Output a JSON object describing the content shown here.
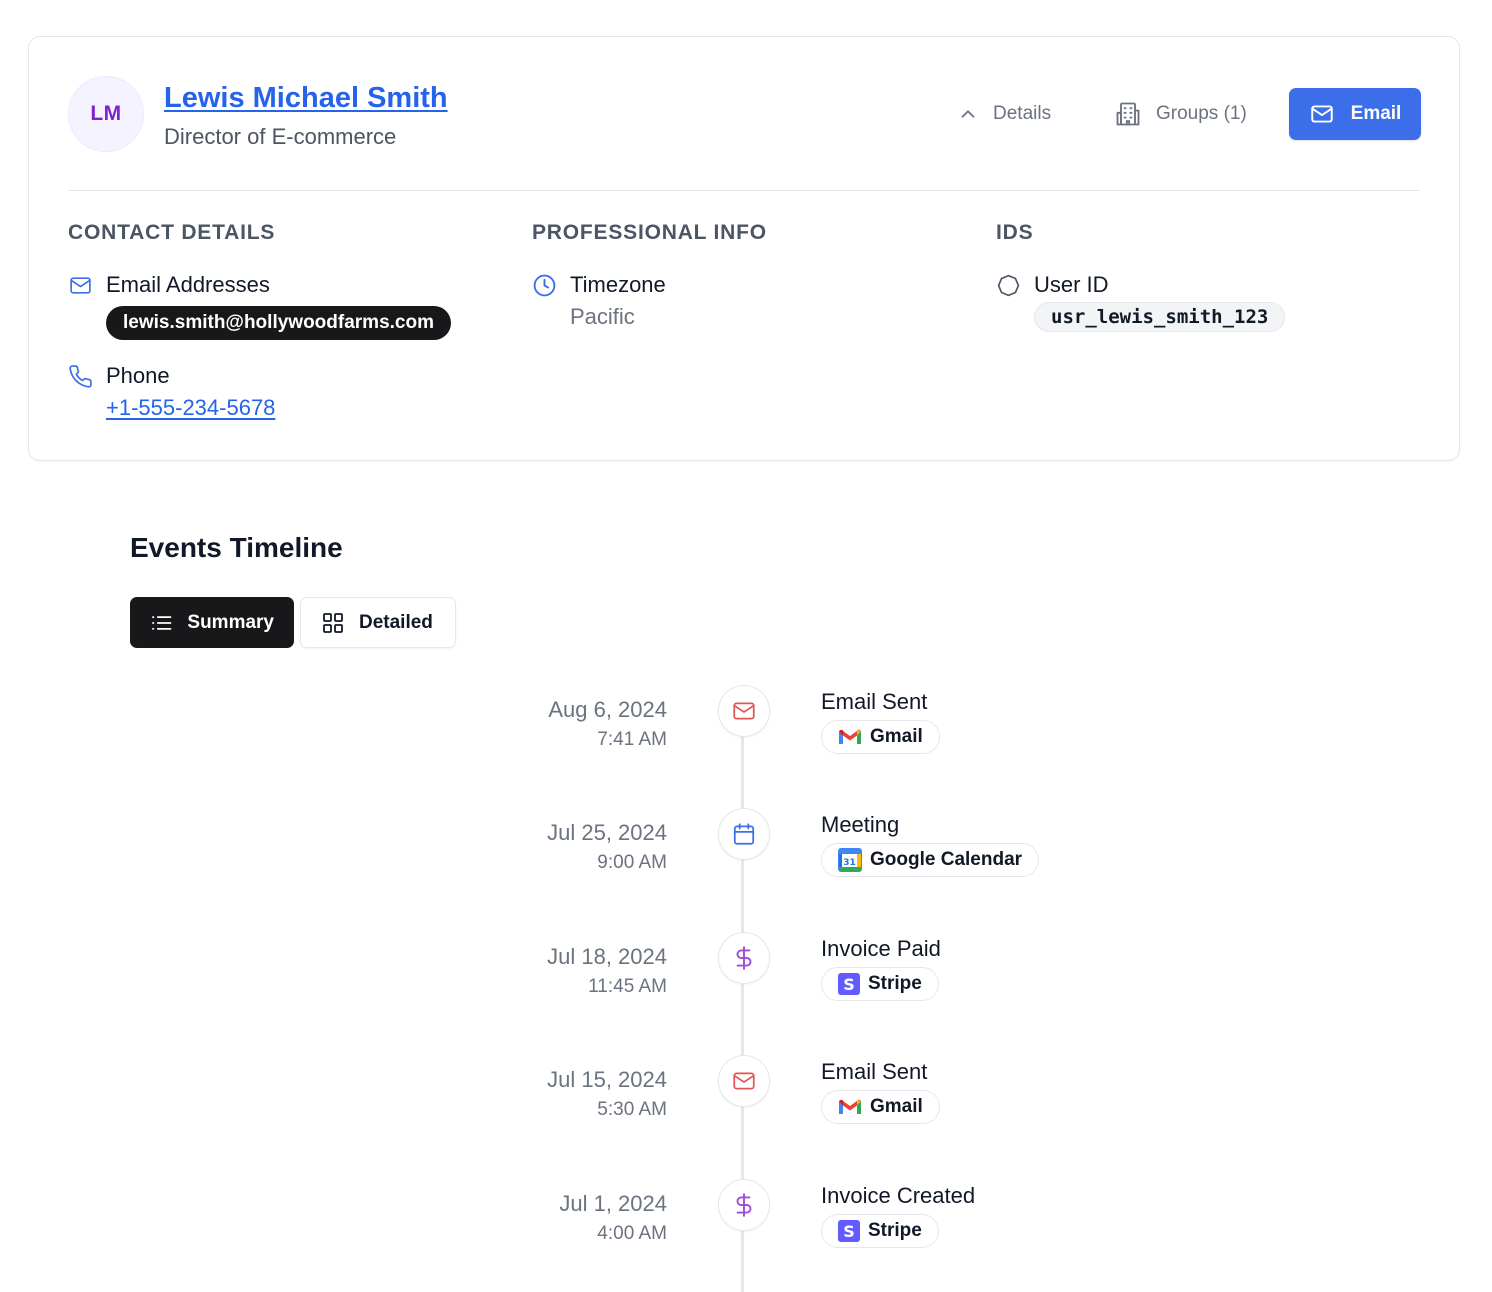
{
  "profile": {
    "initials": "LM",
    "name": "Lewis Michael Smith",
    "job_title": "Director of E-commerce",
    "actions": {
      "details_label": "Details",
      "groups_label": "Groups (1)",
      "email_label": "Email"
    },
    "colors": {
      "accent": "#3b6ee8",
      "avatar_text": "#7e22ce",
      "link": "#2563eb"
    }
  },
  "sections": {
    "contact": {
      "title": "CONTACT DETAILS",
      "email_label": "Email Addresses",
      "email_value": "lewis.smith@hollywoodfarms.com",
      "phone_label": "Phone",
      "phone_value": "+1-555-234-5678"
    },
    "professional": {
      "title": "PROFESSIONAL INFO",
      "timezone_label": "Timezone",
      "timezone_value": "Pacific"
    },
    "ids": {
      "title": "IDS",
      "user_id_label": "User ID",
      "user_id_value": "usr_lewis_smith_123"
    }
  },
  "timeline": {
    "title": "Events Timeline",
    "views": {
      "summary_label": "Summary",
      "detailed_label": "Detailed",
      "active": "Summary"
    },
    "events": [
      {
        "date": "Aug 6, 2024",
        "time": "7:41 AM",
        "title": "Email Sent",
        "source": "Gmail",
        "icon": "mail-icon",
        "source_icon": "gmail-logo-icon"
      },
      {
        "date": "Jul 25, 2024",
        "time": "9:00 AM",
        "title": "Meeting",
        "source": "Google Calendar",
        "icon": "calendar-icon",
        "source_icon": "google-calendar-logo-icon"
      },
      {
        "date": "Jul 18, 2024",
        "time": "11:45 AM",
        "title": "Invoice Paid",
        "source": "Stripe",
        "icon": "dollar-icon",
        "source_icon": "stripe-logo-icon"
      },
      {
        "date": "Jul 15, 2024",
        "time": "5:30 AM",
        "title": "Email Sent",
        "source": "Gmail",
        "icon": "mail-icon",
        "source_icon": "gmail-logo-icon"
      },
      {
        "date": "Jul 1, 2024",
        "time": "4:00 AM",
        "title": "Invoice Created",
        "source": "Stripe",
        "icon": "dollar-icon",
        "source_icon": "stripe-logo-icon"
      }
    ]
  }
}
